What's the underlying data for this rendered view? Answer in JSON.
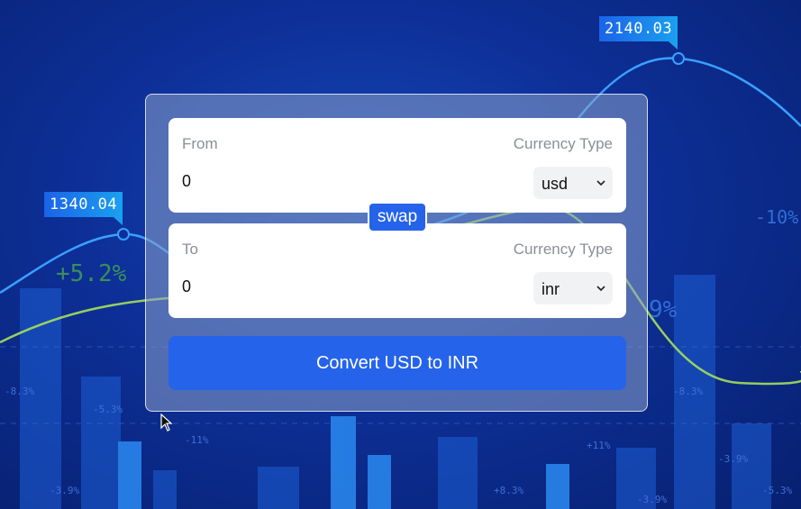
{
  "background": {
    "price_tags": [
      "1340.04",
      "2140.03"
    ],
    "percent_labels": [
      "+5.2%",
      "-10%",
      "9%",
      "-8.3%",
      "-5.3%",
      "-11%",
      "-3.9%",
      "+8.3%",
      "+11%",
      "-3.9%",
      "-8.3%",
      "-5.3%",
      "-3.9%"
    ]
  },
  "converter": {
    "from": {
      "label": "From",
      "currency_label": "Currency Type",
      "amount": "0",
      "currency": "usd"
    },
    "swap_label": "swap",
    "to": {
      "label": "To",
      "currency_label": "Currency Type",
      "amount": "0",
      "currency": "inr"
    },
    "convert_label": "Convert USD to INR"
  },
  "colors": {
    "accent": "#2563eb",
    "background": "#0d2f97"
  }
}
